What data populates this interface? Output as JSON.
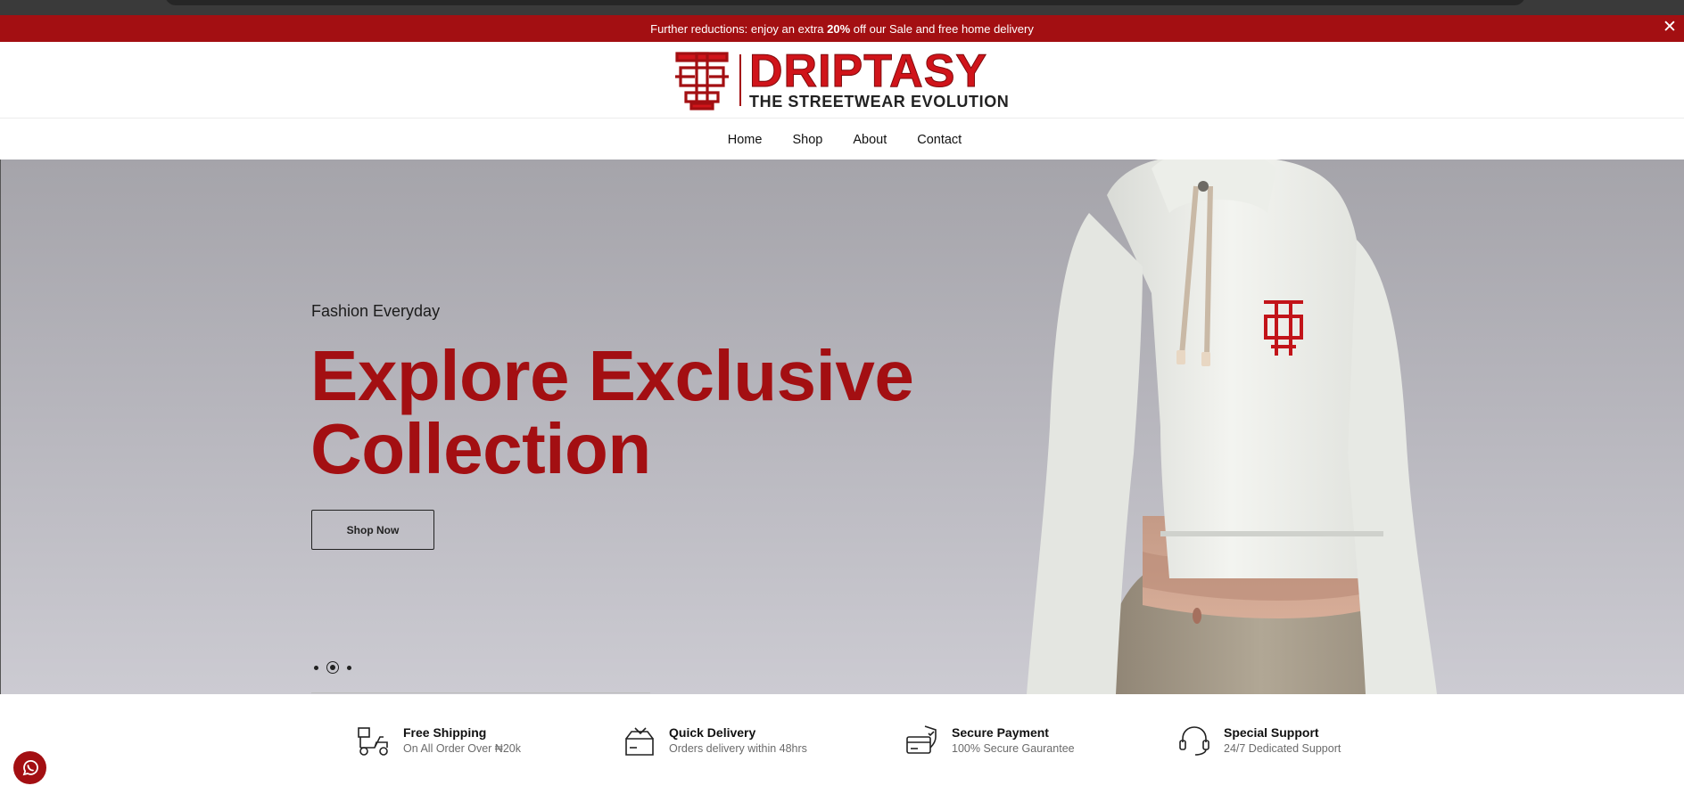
{
  "promo": {
    "text_before": "Further reductions: enjoy an extra ",
    "highlight": "20%",
    "text_after": " off our Sale and free home delivery",
    "close": "✕"
  },
  "brand": {
    "name": "DRIPTASY",
    "tagline": "THE STREETWEAR EVOLUTION"
  },
  "nav": {
    "items": [
      {
        "label": "Home"
      },
      {
        "label": "Shop"
      },
      {
        "label": "About"
      },
      {
        "label": "Contact"
      }
    ]
  },
  "hero": {
    "subtitle": "Fashion Everyday",
    "title_line1": "Explore Exclusive",
    "title_line2": "Collection",
    "button": "Shop Now",
    "slides_total": 3,
    "active_slide": 2
  },
  "features": [
    {
      "icon": "scooter-icon",
      "title": "Free Shipping",
      "desc": "On All Order Over ₦20k"
    },
    {
      "icon": "box-icon",
      "title": "Quick Delivery",
      "desc": "Orders delivery within 48hrs"
    },
    {
      "icon": "card-icon",
      "title": "Secure Payment",
      "desc": "100% Secure Gaurantee"
    },
    {
      "icon": "headset-icon",
      "title": "Special Support",
      "desc": "24/7 Dedicated Support"
    }
  ],
  "colors": {
    "brand_red": "#a30f12",
    "logo_red": "#d0141a",
    "hero_bg": "#b6b5bc"
  }
}
